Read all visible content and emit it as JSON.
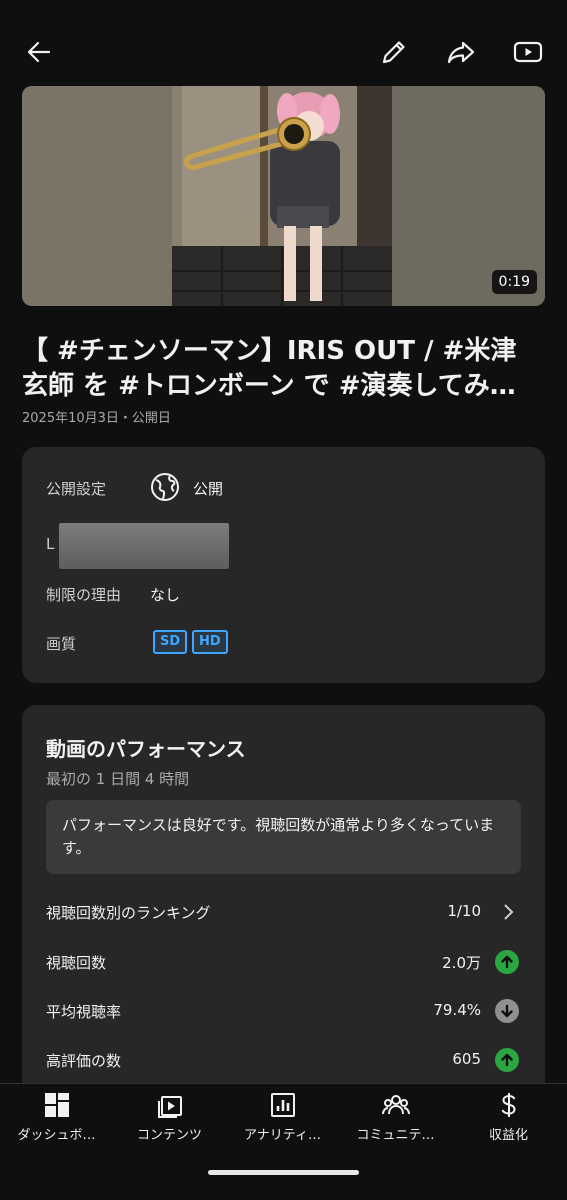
{
  "video": {
    "duration": "0:19",
    "title_line1": "【 #チェンソーマン】IRIS OUT / #米津",
    "title_line2": "玄師 を #トロンボーン で #演奏してみ…",
    "published": "2025年10月3日・公開日"
  },
  "details": {
    "visibility_label": "公開設定",
    "visibility_value": "公開",
    "hidden_label_peek": "L",
    "restriction_label": "制限の理由",
    "restriction_value": "なし",
    "quality_label": "画質",
    "quality_badges": [
      "SD",
      "HD"
    ]
  },
  "performance": {
    "title": "動画のパフォーマンス",
    "period": "最初の 1 日間 4 時間",
    "message": "パフォーマンスは良好です。視聴回数が通常より多くなっています。",
    "metrics": [
      {
        "label": "視聴回数別のランキング",
        "value": "1/10",
        "indicator": "chevron"
      },
      {
        "label": "視聴回数",
        "value": "2.0万",
        "indicator": "up"
      },
      {
        "label": "平均視聴率",
        "value": "79.4%",
        "indicator": "down"
      },
      {
        "label": "高評価の数",
        "value": "605",
        "indicator": "up"
      }
    ]
  },
  "nav": {
    "items": [
      {
        "label": "ダッシュボ…",
        "icon": "dashboard-icon"
      },
      {
        "label": "コンテンツ",
        "icon": "content-icon"
      },
      {
        "label": "アナリティ…",
        "icon": "analytics-icon"
      },
      {
        "label": "コミュニテ…",
        "icon": "community-icon"
      },
      {
        "label": "収益化",
        "icon": "monetization-icon"
      }
    ]
  },
  "colors": {
    "background": "#0f0f0f",
    "card": "#272727",
    "accent_blue": "#3ea6ff",
    "up_green": "#2ba640",
    "down_gray": "#909090"
  }
}
